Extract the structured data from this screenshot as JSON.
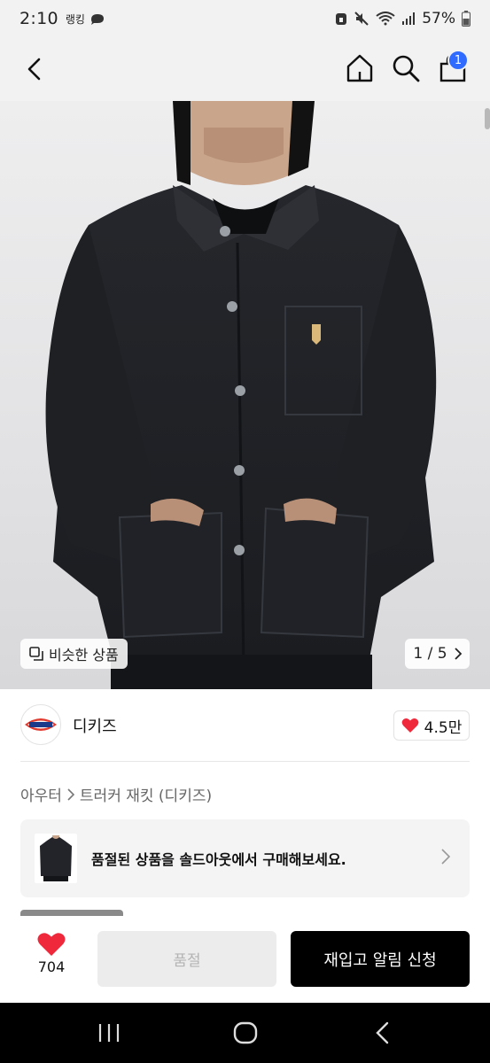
{
  "status_bar": {
    "time": "2:10",
    "app_label": "랭킹",
    "battery": "57%"
  },
  "header": {
    "cart_count": "1"
  },
  "gallery": {
    "similar_label": "비슷한 상품",
    "page_indicator": "1 / 5"
  },
  "brand": {
    "name": "디키즈",
    "like_count": "4.5만"
  },
  "breadcrumb": {
    "category": "아우터",
    "product": "트러커 재킷 (디키즈)"
  },
  "soldout_banner": {
    "text": "품절된 상품을 솔드아웃에서 구매해보세요."
  },
  "bottom_bar": {
    "wish_count": "704",
    "soldout_label": "품절",
    "restock_label": "재입고 알림 신청"
  },
  "colors": {
    "accent_badge": "#2f6bff",
    "heart": "#f0283c",
    "primary_button": "#000000"
  },
  "icons": [
    "back-arrow-icon",
    "home-icon",
    "search-icon",
    "cart-icon",
    "similar-items-icon",
    "chevron-right-icon",
    "heart-icon"
  ]
}
